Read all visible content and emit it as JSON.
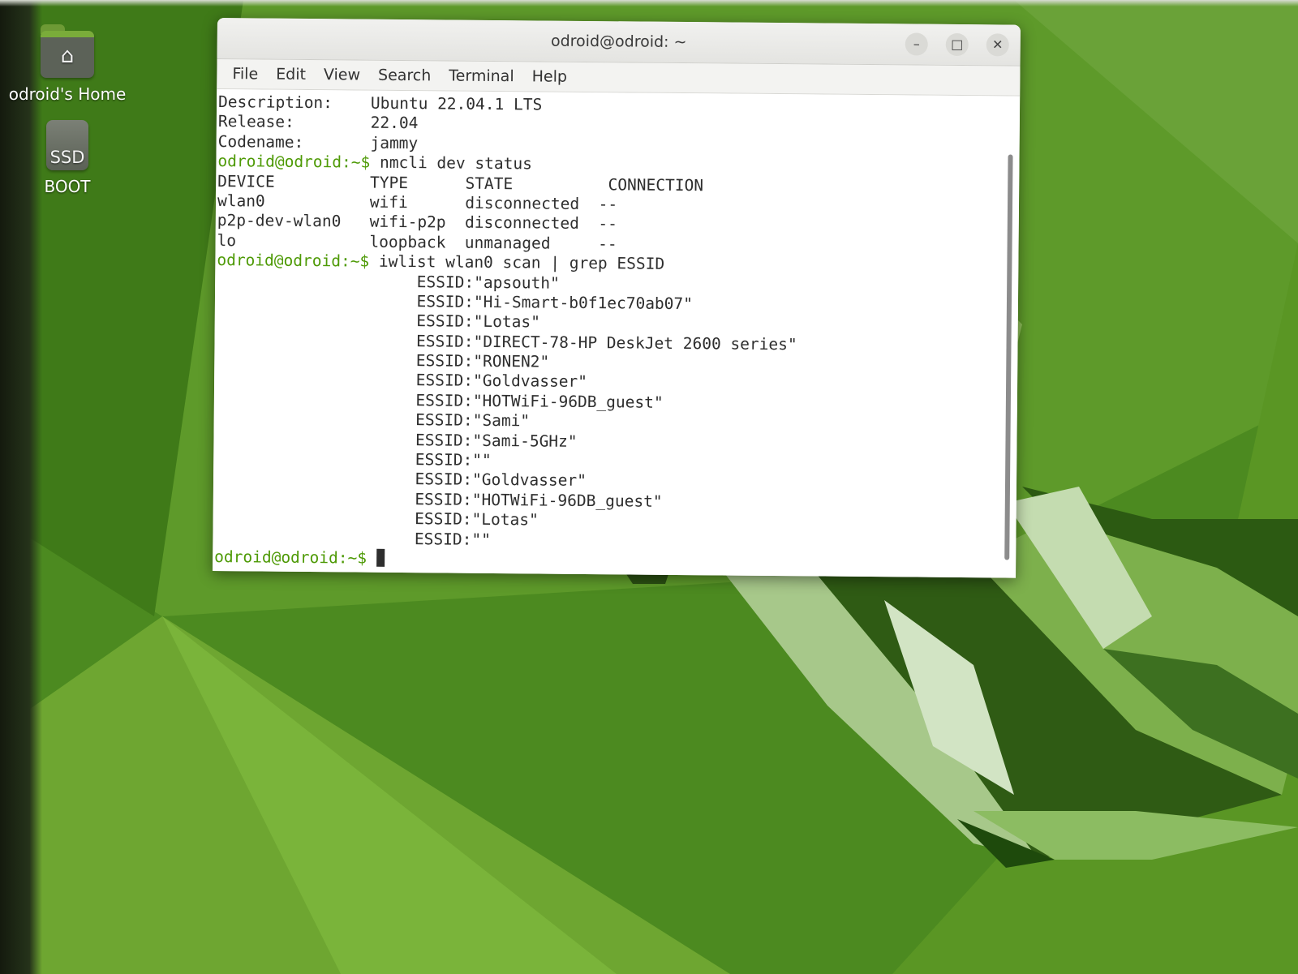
{
  "desktop": {
    "icons": [
      {
        "label": "odroid's Home",
        "icon": "home-folder-icon",
        "glyph": "⌂"
      },
      {
        "label": "BOOT",
        "icon": "drive-icon",
        "glyph_text": "SSD"
      }
    ]
  },
  "window": {
    "title": "odroid@odroid: ~",
    "controls": {
      "minimize": "–",
      "maximize": "□",
      "close": "✕"
    },
    "menu": [
      "File",
      "Edit",
      "View",
      "Search",
      "Terminal",
      "Help"
    ]
  },
  "terminal": {
    "prompt": "odroid@odroid:~$",
    "lsb": [
      {
        "key": "Description:",
        "value": "Ubuntu 22.04.1 LTS"
      },
      {
        "key": "Release:",
        "value": "22.04"
      },
      {
        "key": "Codename:",
        "value": "jammy"
      }
    ],
    "cmd1": "nmcli dev status",
    "table_header": [
      "DEVICE",
      "TYPE",
      "STATE",
      "CONNECTION"
    ],
    "table_rows": [
      [
        "wlan0",
        "wifi",
        "disconnected",
        "--"
      ],
      [
        "p2p-dev-wlan0",
        "wifi-p2p",
        "disconnected",
        "--"
      ],
      [
        "lo",
        "loopback",
        "unmanaged",
        "--"
      ]
    ],
    "cmd2": "iwlist wlan0 scan | grep ESSID",
    "essids": [
      "ESSID:\"apsouth\"",
      "ESSID:\"Hi-Smart-b0f1ec70ab07\"",
      "ESSID:\"Lotas\"",
      "ESSID:\"DIRECT-78-HP DeskJet 2600 series\"",
      "ESSID:\"RONEN2\"",
      "ESSID:\"Goldvasser\"",
      "ESSID:\"HOTWiFi-96DB_guest\"",
      "ESSID:\"Sami\"",
      "ESSID:\"Sami-5GHz\"",
      "ESSID:\"\"",
      "ESSID:\"Goldvasser\"",
      "ESSID:\"HOTWiFi-96DB_guest\"",
      "ESSID:\"Lotas\"",
      "ESSID:\"\""
    ]
  },
  "colors": {
    "prompt": "#4e9a06",
    "text": "#2e2e2e",
    "wallpaper": "#4e8a22"
  }
}
